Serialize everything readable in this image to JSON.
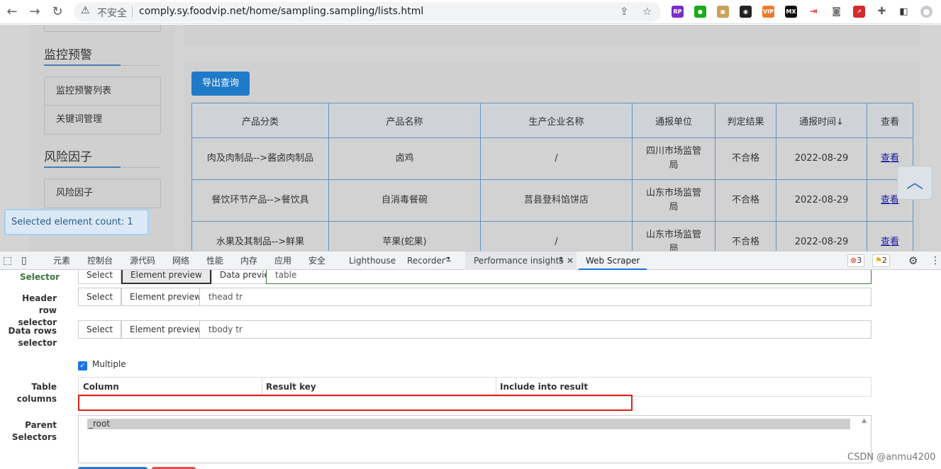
{
  "browser": {
    "back": "←",
    "forward": "→",
    "reload": "↻",
    "insecure_label": "不安全",
    "url": "comply.sy.foodvip.net/home/sampling.sampling/lists.html",
    "ext_rp": "RP",
    "ext_vip": "VIP",
    "ext_mx": "MX"
  },
  "sidebar": {
    "sections": [
      {
        "title": "监控预警",
        "items": [
          "监控预警列表",
          "关键词管理"
        ]
      },
      {
        "title": "风险因子",
        "items": [
          "风险因子"
        ]
      }
    ],
    "selected_count": "Selected element count: 1"
  },
  "main": {
    "export_label": "导出查询",
    "headers": [
      "产品分类",
      "产品名称",
      "生产企业名称",
      "通报单位",
      "判定结果",
      "通报时间↓",
      "查看"
    ],
    "rows": [
      {
        "category": "肉及肉制品-->酱卤肉制品",
        "name": "卤鸡",
        "company": "/",
        "unit": "四川市场监管局",
        "result": "不合格",
        "date": "2022-08-29",
        "view": "查看"
      },
      {
        "category": "餐饮环节产品-->餐饮具",
        "name": "自消毒餐碗",
        "company": "莒县登科馅饼店",
        "unit": "山东市场监管局",
        "result": "不合格",
        "date": "2022-08-29",
        "view": "查看"
      },
      {
        "category": "水果及其制品-->鲜果",
        "name": "苹果(蛇果)",
        "company": "/",
        "unit": "山东市场监管局",
        "result": "不合格",
        "date": "2022-08-29",
        "view": "查看"
      }
    ]
  },
  "devtools": {
    "tabs": [
      "元素",
      "控制台",
      "源代码",
      "网络",
      "性能",
      "内存",
      "应用",
      "安全",
      "Lighthouse",
      "Recorder",
      "Performance insights",
      "Web Scraper"
    ],
    "errors": "3",
    "warnings": "2"
  },
  "scraper": {
    "selector_label": "Selector",
    "header_row_label": "Header row selector",
    "data_rows_label": "Data rows selector",
    "table_columns_label": "Table columns",
    "parent_label": "Parent Selectors",
    "btn_select": "Select",
    "btn_element_preview": "Element preview",
    "btn_data_preview": "Data preview",
    "selector_value": "table",
    "header_row_value": "thead tr",
    "data_rows_value": "tbody tr",
    "multiple_label": "Multiple",
    "col_column": "Column",
    "col_result_key": "Result key",
    "col_include": "Include into result",
    "parent_option": "_root"
  },
  "watermark": "CSDN @anmu4200"
}
